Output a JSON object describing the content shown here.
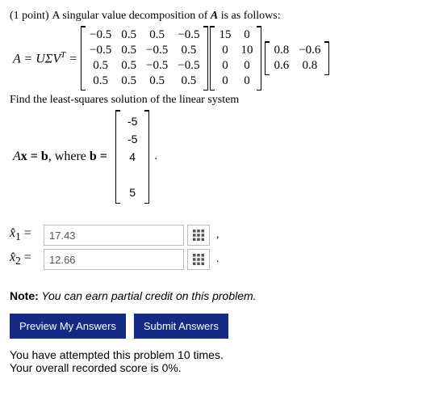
{
  "points": "(1 point)",
  "prompt_a": "A singular value decomposition of ",
  "A_sym": "A",
  "prompt_b": " is as follows:",
  "lhs": "A = UΣV",
  "lhs_sup": "T",
  "equals": " =",
  "U": [
    [
      "−0.5",
      "0.5",
      "0.5",
      "−0.5"
    ],
    [
      "−0.5",
      "0.5",
      "−0.5",
      "0.5"
    ],
    [
      "0.5",
      "0.5",
      "−0.5",
      "−0.5"
    ],
    [
      "0.5",
      "0.5",
      "0.5",
      "0.5"
    ]
  ],
  "S": [
    [
      "15",
      "0"
    ],
    [
      "0",
      "10"
    ],
    [
      "0",
      "0"
    ],
    [
      "0",
      "0"
    ]
  ],
  "V": [
    [
      "0.8",
      "−0.6"
    ],
    [
      "0.6",
      "0.8"
    ]
  ],
  "find_text": "Find the least-squares solution of the linear system",
  "eq2_a": "A",
  "eq2_b": "x = b",
  "eq2_c": ", where ",
  "eq2_d": "b =",
  "b_vec": [
    "-5",
    "-5",
    "4",
    "",
    "5"
  ],
  "period": ".",
  "x1_label_a": "x̂",
  "x1_sub": "1",
  "x1_eq": " = ",
  "x1_val": "17.43",
  "comma": ",",
  "x2_sub": "2",
  "x2_val": "12.66",
  "note_b": "Note:",
  "note_i": " You can earn partial credit on this problem.",
  "btn_preview": "Preview My Answers",
  "btn_submit": "Submit Answers",
  "foot1": "You have attempted this problem 10 times.",
  "foot2": "Your overall recorded score is 0%.",
  "chart_data": {
    "type": "table",
    "matrices": {
      "U": [
        [
          -0.5,
          0.5,
          0.5,
          -0.5
        ],
        [
          -0.5,
          0.5,
          -0.5,
          0.5
        ],
        [
          0.5,
          0.5,
          -0.5,
          -0.5
        ],
        [
          0.5,
          0.5,
          0.5,
          0.5
        ]
      ],
      "Sigma": [
        [
          15,
          0
        ],
        [
          0,
          10
        ],
        [
          0,
          0
        ],
        [
          0,
          0
        ]
      ],
      "V_transpose": [
        [
          0.8,
          -0.6
        ],
        [
          0.6,
          0.8
        ]
      ],
      "b": [
        -5,
        -5,
        4,
        null,
        5
      ]
    },
    "answers": {
      "x_hat_1": 17.43,
      "x_hat_2": 12.66
    }
  }
}
